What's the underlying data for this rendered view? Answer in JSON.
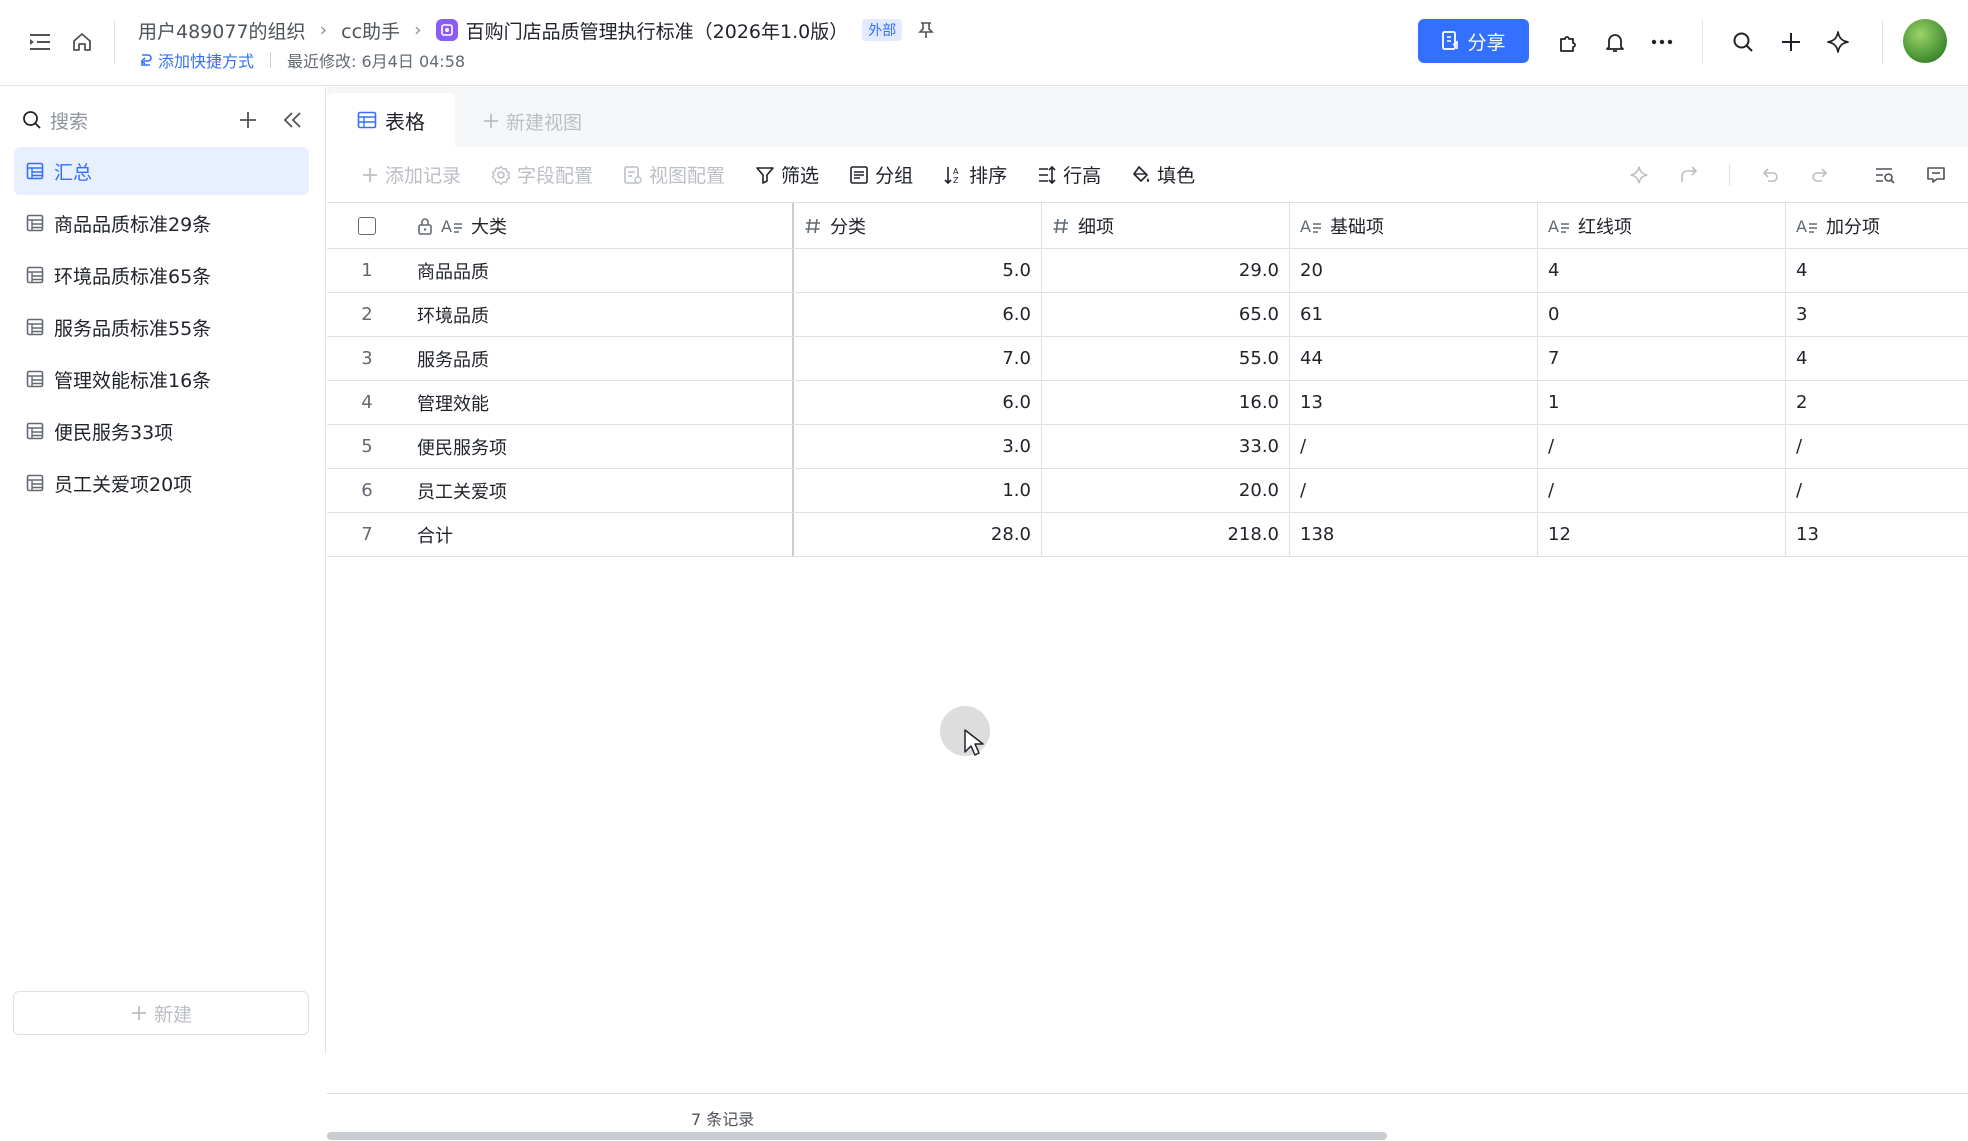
{
  "topbar": {
    "breadcrumbs": [
      "用户489077的组织",
      "cc助手"
    ],
    "doc_title": "百购门店品质管理执行标准（2026年1.0版）",
    "badge": "外部",
    "shortcut": "添加快捷方式",
    "last_modified": "最近修改: 6月4日 04:58",
    "share_label": "分享"
  },
  "sidebar": {
    "search_placeholder": "搜索",
    "items": [
      {
        "label": "汇总",
        "active": true
      },
      {
        "label": "商品品质标准29条"
      },
      {
        "label": "环境品质标准65条"
      },
      {
        "label": "服务品质标准55条"
      },
      {
        "label": "管理效能标准16条"
      },
      {
        "label": "便民服务33项"
      },
      {
        "label": "员工关爱项20项"
      }
    ],
    "new_label": "新建"
  },
  "view": {
    "active_tab": "表格",
    "new_view": "新建视图"
  },
  "toolbar": {
    "add_record": "添加记录",
    "field_config": "字段配置",
    "view_config": "视图配置",
    "filter": "筛选",
    "group": "分组",
    "sort": "排序",
    "row_height": "行高",
    "fill_color": "填色"
  },
  "table": {
    "columns": [
      "大类",
      "分类",
      "细项",
      "基础项",
      "红线项",
      "加分项"
    ],
    "rows": [
      {
        "idx": "1",
        "cells": [
          "商品品质",
          "5.0",
          "29.0",
          "20",
          "4",
          "4"
        ]
      },
      {
        "idx": "2",
        "cells": [
          "环境品质",
          "6.0",
          "65.0",
          "61",
          "0",
          "3"
        ]
      },
      {
        "idx": "3",
        "cells": [
          "服务品质",
          "7.0",
          "55.0",
          "44",
          "7",
          "4"
        ]
      },
      {
        "idx": "4",
        "cells": [
          "管理效能",
          "6.0",
          "16.0",
          "13",
          "1",
          "2"
        ]
      },
      {
        "idx": "5",
        "cells": [
          "便民服务项",
          "3.0",
          "33.0",
          "/",
          "/",
          "/"
        ]
      },
      {
        "idx": "6",
        "cells": [
          "员工关爱项",
          "1.0",
          "20.0",
          "/",
          "/",
          "/"
        ]
      },
      {
        "idx": "7",
        "cells": [
          "合计",
          "28.0",
          "218.0",
          "138",
          "12",
          "13"
        ]
      }
    ]
  },
  "footer": {
    "record_count": "7 条记录"
  },
  "colors": {
    "accent": "#3370ff",
    "active_bg": "#e8effe"
  }
}
